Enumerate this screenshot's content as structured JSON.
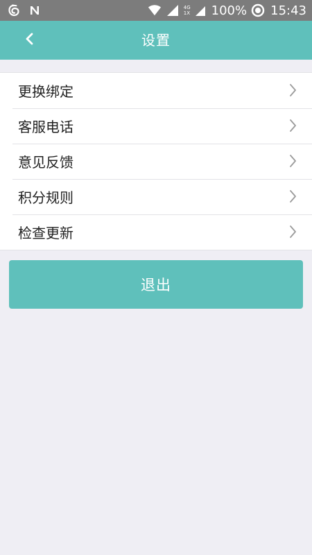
{
  "status_bar": {
    "battery": "100%",
    "time": "15:43",
    "network_top": "4G",
    "network_bottom": "1X",
    "icons": [
      "weibo-icon",
      "n-icon",
      "wifi-icon",
      "signal-icon",
      "battery-circle-icon"
    ]
  },
  "header": {
    "title": "设置",
    "background": "#5fc0bb"
  },
  "menu": {
    "items": [
      {
        "label": "更换绑定"
      },
      {
        "label": "客服电话"
      },
      {
        "label": "意见反馈"
      },
      {
        "label": "积分规则"
      },
      {
        "label": "检查更新"
      }
    ]
  },
  "logout": {
    "label": "退出"
  }
}
